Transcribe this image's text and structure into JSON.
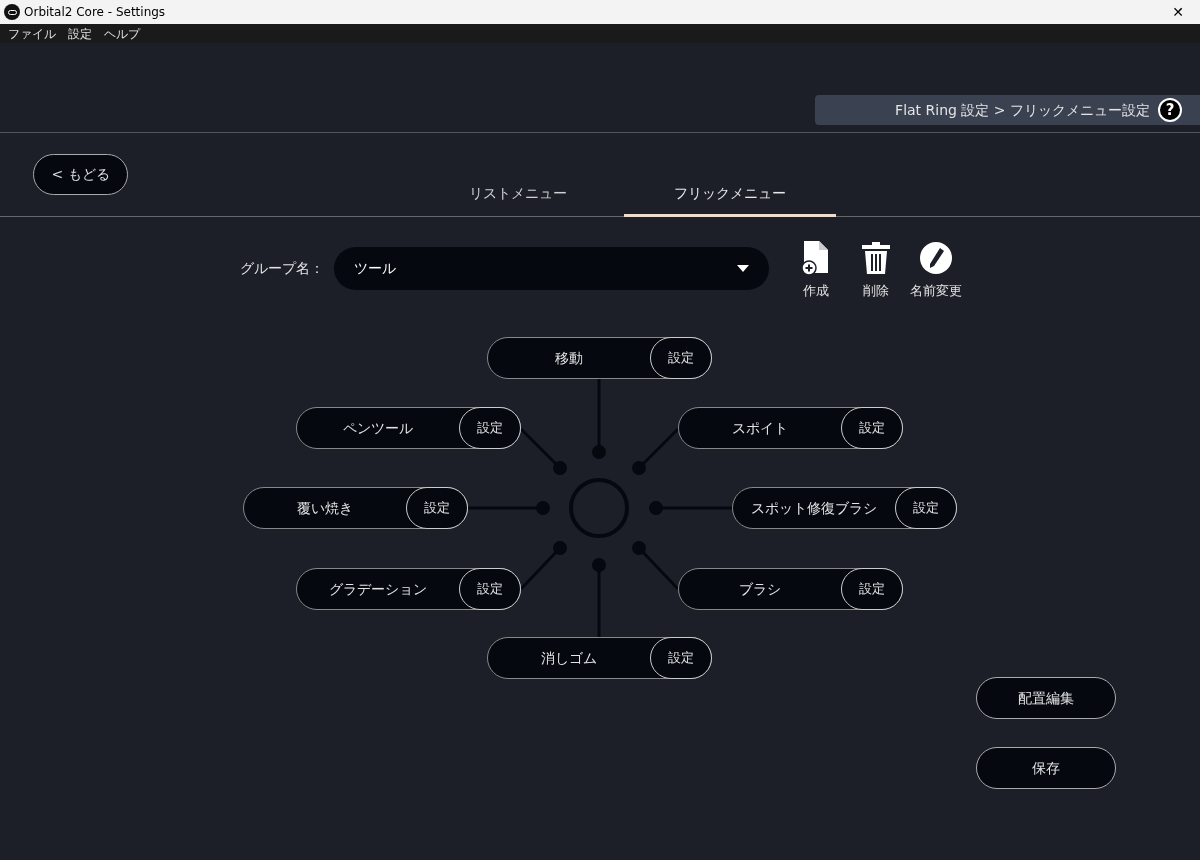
{
  "window": {
    "title": "Orbital2 Core - Settings",
    "close": "✕"
  },
  "menu": [
    "ファイル",
    "設定",
    "ヘルプ"
  ],
  "breadcrumb": {
    "text": "Flat Ring 設定 > フリックメニュー設定",
    "help": "?"
  },
  "back_button": "< もどる",
  "tabs": [
    {
      "label": "リストメニュー",
      "selected": false
    },
    {
      "label": "フリックメニュー",
      "selected": true
    }
  ],
  "group": {
    "label": "グループ名：",
    "value": "ツール"
  },
  "actions": [
    {
      "kind": "create",
      "label": "作成"
    },
    {
      "kind": "delete",
      "label": "削除"
    },
    {
      "kind": "rename",
      "label": "名前変更"
    }
  ],
  "flick_items": [
    {
      "label": "移動",
      "button": "設定"
    },
    {
      "label": "スポイト",
      "button": "設定"
    },
    {
      "label": "スポット修復ブラシ",
      "button": "設定"
    },
    {
      "label": "ブラシ",
      "button": "設定"
    },
    {
      "label": "消しゴム",
      "button": "設定"
    },
    {
      "label": "グラデーション",
      "button": "設定"
    },
    {
      "label": "覆い焼き",
      "button": "設定"
    },
    {
      "label": "ペンツール",
      "button": "設定"
    }
  ],
  "buttons": [
    "配置編集",
    "保存"
  ]
}
